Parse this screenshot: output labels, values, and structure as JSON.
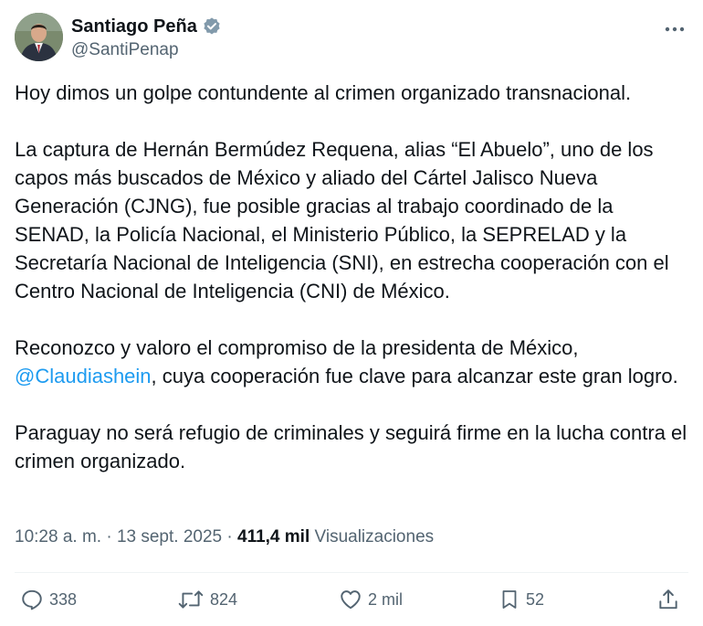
{
  "author": {
    "display_name": "Santiago Peña",
    "handle": "@SantiPenap",
    "verified": true
  },
  "more_menu": {
    "icon": "more-horizontal-icon"
  },
  "tweet": {
    "paragraph_1": "Hoy dimos un golpe contundente al crimen organizado transnacional.",
    "paragraph_2": "La captura de Hernán Bermúdez Requena, alias “El Abuelo”, uno de los capos más buscados de México y aliado del Cártel Jalisco Nueva Generación (CJNG), fue posible gracias al trabajo coordinado de la SENAD, la Policía Nacional, el Ministerio Público, la SEPRELAD y la Secretaría Nacional de Inteligencia (SNI), en estrecha cooperación con el Centro Nacional de Inteligencia (CNI) de México.",
    "paragraph_3_before": "Reconozco y valoro el compromiso de la presidenta de México, ",
    "paragraph_3_mention": "@Claudiashein",
    "paragraph_3_after": ", cuya cooperación fue clave para alcanzar este gran logro.",
    "paragraph_4": "Paraguay no será refugio de criminales y seguirá firme en la lucha contra el crimen organizado."
  },
  "meta": {
    "time": "10:28 a. m.",
    "separator": "·",
    "date": "13 sept. 2025",
    "views_count": "411,4 mil",
    "views_label": "Visualizaciones"
  },
  "actions": {
    "replies": "338",
    "reposts": "824",
    "likes": "2 mil",
    "bookmarks": "52"
  },
  "colors": {
    "text_primary": "#0f1419",
    "text_secondary": "#536471",
    "accent": "#1d9bf0",
    "divider": "#eff3f4"
  }
}
